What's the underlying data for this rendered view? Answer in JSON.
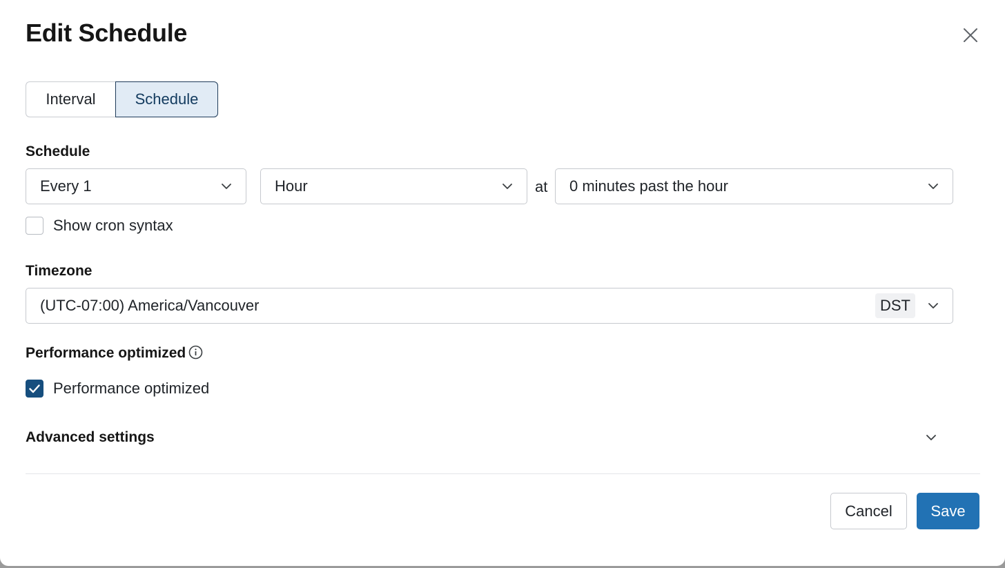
{
  "dialog": {
    "title": "Edit Schedule",
    "close_icon": "close-icon"
  },
  "tabs": [
    {
      "label": "Interval",
      "active": false
    },
    {
      "label": "Schedule",
      "active": true
    }
  ],
  "schedule": {
    "label": "Schedule",
    "every_value": "Every 1",
    "unit_value": "Hour",
    "at_label": "at",
    "minute_value": "0 minutes past the hour",
    "show_cron_label": "Show cron syntax",
    "show_cron_checked": false
  },
  "timezone": {
    "label": "Timezone",
    "value": "(UTC-07:00) America/Vancouver",
    "badge": "DST"
  },
  "performance": {
    "label": "Performance optimized",
    "info_icon": "info-icon",
    "checkbox_label": "Performance optimized",
    "checked": true
  },
  "advanced": {
    "label": "Advanced settings",
    "expanded": false
  },
  "footer": {
    "cancel_label": "Cancel",
    "save_label": "Save"
  },
  "colors": {
    "primary": "#2272b4",
    "checkbox_checked": "#164e7e",
    "tab_active_bg": "#e1ebf5",
    "tab_active_border": "#1d3a58"
  }
}
